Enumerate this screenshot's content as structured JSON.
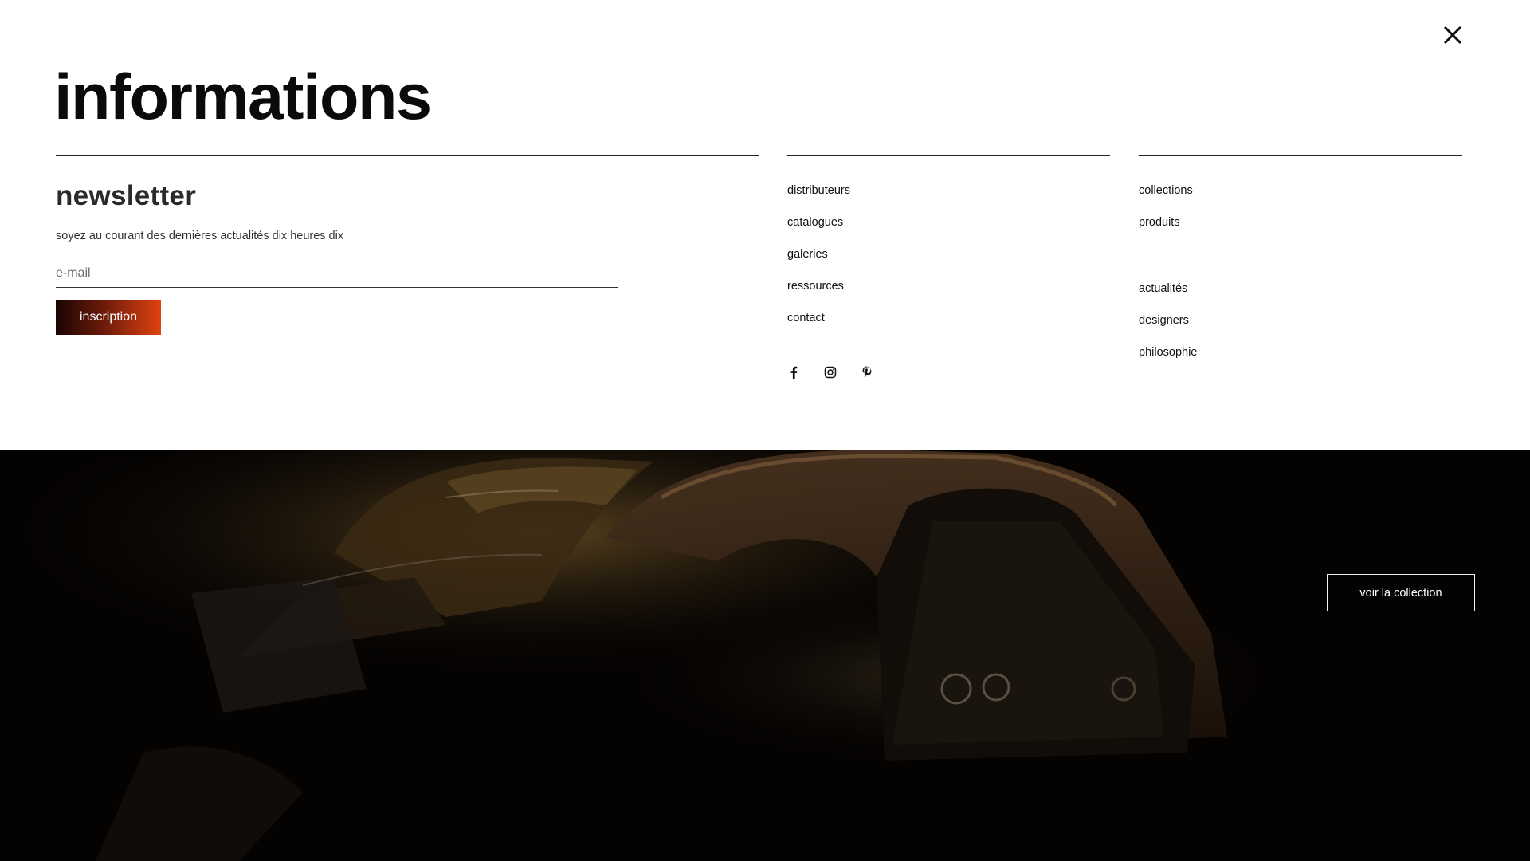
{
  "panel": {
    "title": "informations",
    "close_icon": "close-icon"
  },
  "newsletter": {
    "title": "newsletter",
    "description": "soyez au courant des dernières actualités dix heures dix",
    "email_placeholder": "e-mail",
    "email_value": "",
    "subscribe_label": "inscription",
    "subscribe_gradient": [
      "#1a0503",
      "#e0430f"
    ]
  },
  "links_primary": [
    {
      "label": "distributeurs"
    },
    {
      "label": "catalogues"
    },
    {
      "label": "galeries"
    },
    {
      "label": "ressources"
    },
    {
      "label": "contact"
    }
  ],
  "social": [
    {
      "icon": "facebook-icon"
    },
    {
      "icon": "instagram-icon"
    },
    {
      "icon": "pinterest-icon"
    }
  ],
  "links_secondary_top": [
    {
      "label": "collections"
    },
    {
      "label": "produits"
    }
  ],
  "links_secondary_bottom": [
    {
      "label": "actualités"
    },
    {
      "label": "designers"
    },
    {
      "label": "philosophie"
    }
  ],
  "hero": {
    "cta_label": "voir la collection",
    "image": "dark photograph of a rusted vintage car body"
  },
  "colors": {
    "panel_bg": "#ffffff",
    "text": "#111111",
    "hero_bg": "#050302"
  }
}
